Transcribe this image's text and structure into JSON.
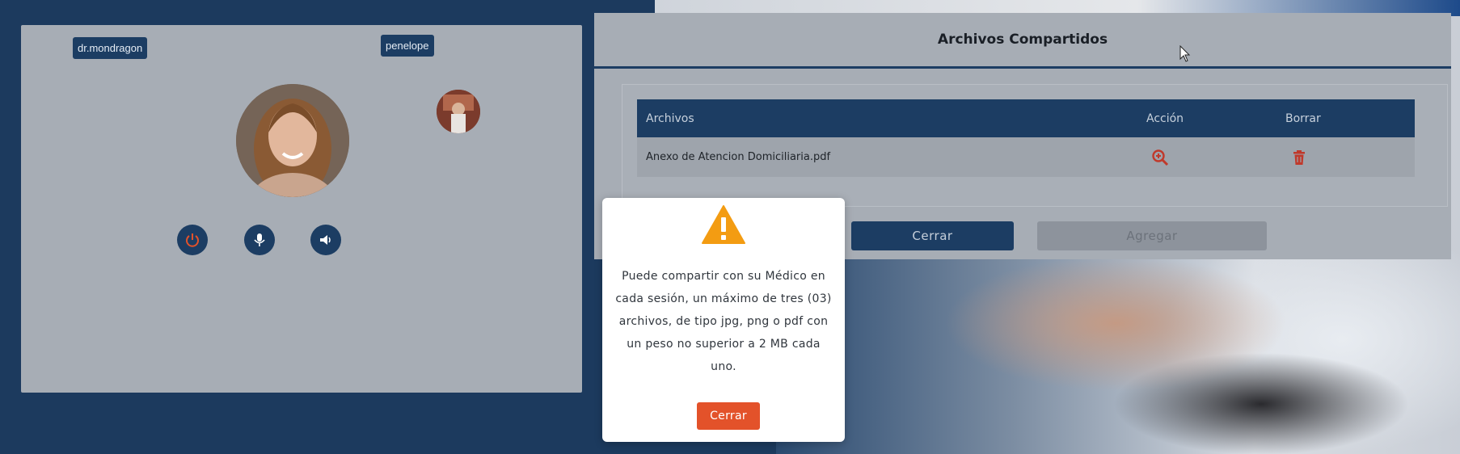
{
  "video": {
    "participant_left": "dr.mondragon",
    "participant_right": "penelope",
    "controls": [
      "power-icon",
      "microphone-icon",
      "speaker-icon"
    ]
  },
  "files": {
    "title": "Archivos Compartidos",
    "columns": [
      "Archivos",
      "Acción",
      "Borrar"
    ],
    "rows": [
      {
        "name": "Anexo de Atencion Domiciliaria.pdf",
        "action_icon": "zoom-in-icon",
        "delete_icon": "trash-icon"
      }
    ],
    "close_label": "Cerrar",
    "add_label": "Agregar"
  },
  "modal": {
    "icon": "warning-icon",
    "message": "Puede compartir con su Médico en cada sesión, un máximo de tres (03) archivos, de tipo jpg, png o pdf con un peso no superior a 2 MB cada uno.",
    "close_label": "Cerrar"
  },
  "colors": {
    "navy": "#1c3d63",
    "accent_orange": "#e3522a",
    "warning": "#f39c12"
  }
}
